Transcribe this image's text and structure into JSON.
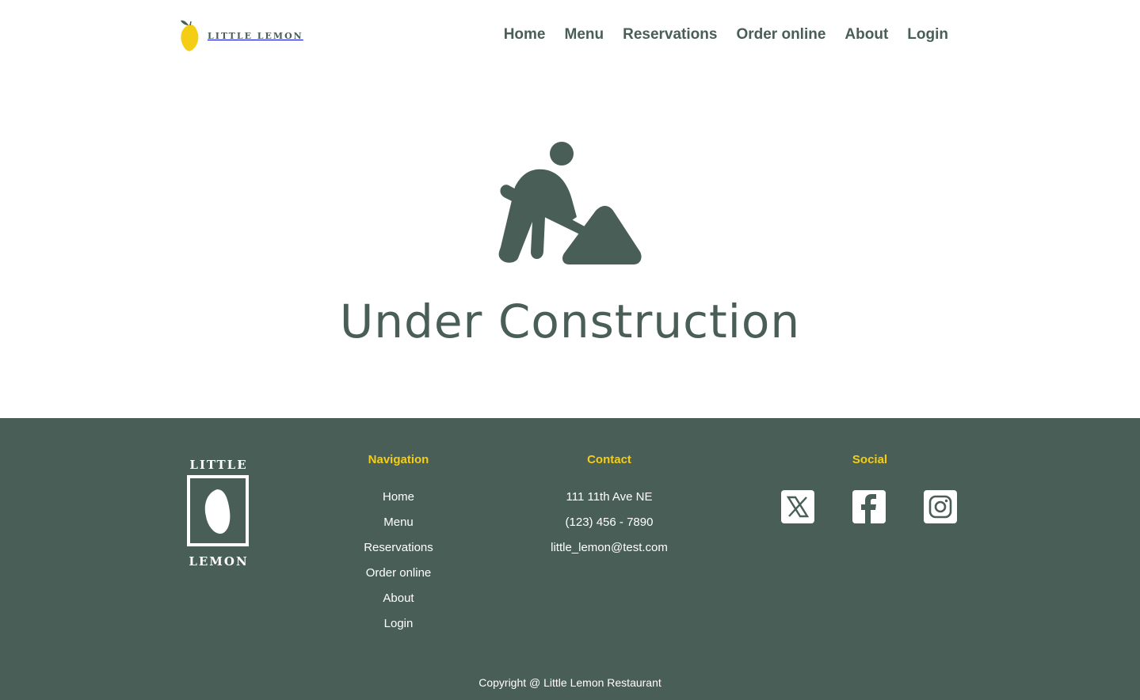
{
  "header": {
    "logo_text": "LITTLE LEMON",
    "nav": [
      {
        "label": "Home"
      },
      {
        "label": "Menu"
      },
      {
        "label": "Reservations"
      },
      {
        "label": "Order online"
      },
      {
        "label": "About"
      },
      {
        "label": "Login"
      }
    ]
  },
  "main": {
    "icon": "construction-worker-icon",
    "title": "Under Construction"
  },
  "footer": {
    "logo": {
      "top_text": "LITTLE",
      "bottom_text": "LEMON"
    },
    "navigation": {
      "title": "Navigation",
      "items": [
        "Home",
        "Menu",
        "Reservations",
        "Order online",
        "About",
        "Login"
      ]
    },
    "contact": {
      "title": "Contact",
      "address": "111 11th Ave NE",
      "phone": "(123) 456 - 7890",
      "email": "little_lemon@test.com"
    },
    "social": {
      "title": "Social",
      "icons": [
        "x-twitter-icon",
        "facebook-icon",
        "instagram-icon"
      ]
    },
    "copyright": "Copyright @ Little Lemon Restaurant"
  },
  "colors": {
    "primary_green": "#495e57",
    "accent_yellow": "#f4ce14",
    "white": "#ffffff"
  }
}
